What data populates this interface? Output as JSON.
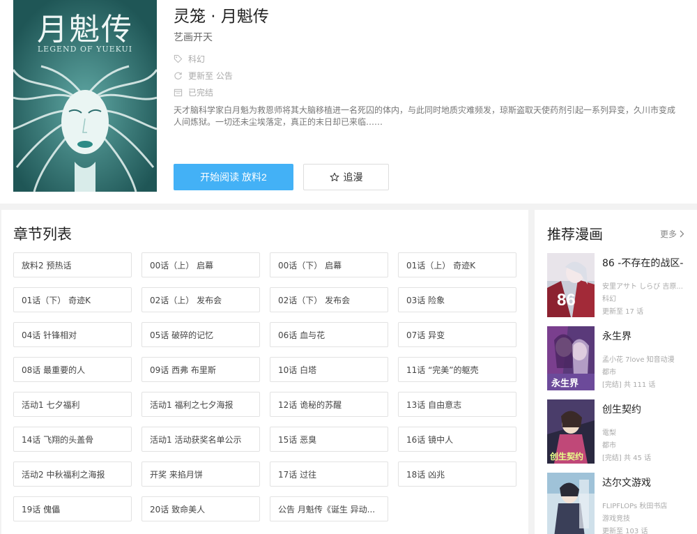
{
  "colors": {
    "accent": "#43b1f6",
    "cover_bg": "#2c6e6e"
  },
  "comic": {
    "title": "灵笼 · 月魁传",
    "author": "艺画开天",
    "genre": "科幻",
    "update": "更新至 公告",
    "status": "已完结",
    "description": "天才脑科学家白月魁为救恩师将其大脑移植进一名死囚的体内，与此同时地质灾难频发，琼斯盗取天使药剂引起一系列异变，久川市变成人间炼狱。一切还未尘埃落定，真正的末日却已来临……",
    "cover": {
      "title": "月魁传",
      "subtitle": "LEGEND OF YUEKUI"
    },
    "icons": {
      "genre": "tag-icon",
      "update": "refresh-icon",
      "status": "calendar-icon"
    }
  },
  "actions": {
    "read_label": "开始阅读 放料2",
    "follow_label": "追漫",
    "follow_icon": "star-icon"
  },
  "chapters": {
    "title": "章节列表",
    "items": [
      "放料2  预热话",
      "00话（上）  启幕",
      "00话（下）  启幕",
      "01话（上）  奇迹K",
      "01话（下）  奇迹K",
      "02话（上）  发布会",
      "02话（下）  发布会",
      "03话  险象",
      "04话  针锋相对",
      "05话  破碎的记忆",
      "06话  血与花",
      "07话  异变",
      "08话  最重要的人",
      "09话  西弗 布里斯",
      "10话  白塔",
      "11话  “完美”的躯壳",
      "活动1  七夕福利",
      "活动1  福利之七夕海报",
      "12话  诡秘的苏醒",
      "13话  自由意志",
      "14话  飞翔的头盖骨",
      "活动1  活动获奖名单公示",
      "15话  恶臭",
      "16话  镜中人",
      "活动2  中秋福利之海报",
      "开奖  来掐月饼",
      "17话  过往",
      "18话  凶兆",
      "19话  傀儡",
      "20话  致命美人",
      "公告  月魁传《诞生 异动..."
    ]
  },
  "recommendations": {
    "title": "推荐漫画",
    "more_label": "更多",
    "items": [
      {
        "name": "86 -不存在的战区-",
        "author": "安里アサト しらび 吉原...",
        "genre": "科幻",
        "update": "更新至 17 话"
      },
      {
        "name": "永生界",
        "author": "孟小花 7love 知音动漫",
        "genre": "都市",
        "update": "[完结] 共 111 话"
      },
      {
        "name": "创生契约",
        "author": "電梨",
        "genre": "都市",
        "update": "[完结] 共 45 话"
      },
      {
        "name": "达尔文游戏",
        "author": "FLIPFLOPs 秋田书店",
        "genre": "游戏竞技",
        "update": "更新至 103 话"
      }
    ]
  }
}
